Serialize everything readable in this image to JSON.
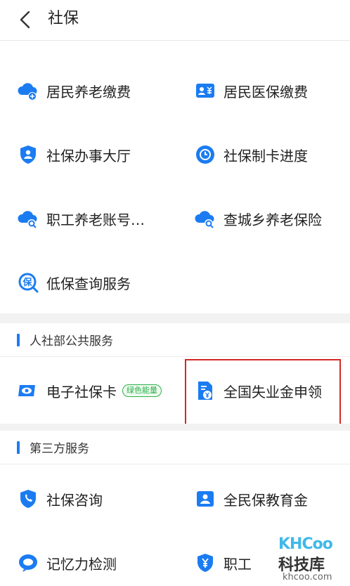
{
  "header": {
    "title": "社保"
  },
  "grid1": [
    {
      "label": "居民养老缴费",
      "icon": "cloud-plus-icon"
    },
    {
      "label": "居民医保缴费",
      "icon": "id-card-yuan-icon"
    },
    {
      "label": "社保办事大厅",
      "icon": "shield-person-icon"
    },
    {
      "label": "社保制卡进度",
      "icon": "clock-progress-icon"
    },
    {
      "label": "职工养老账号…",
      "icon": "cloud-search-icon"
    },
    {
      "label": "查城乡养老保险",
      "icon": "cloud-search-icon"
    },
    {
      "label": "低保查询服务",
      "icon": "bao-search-icon"
    }
  ],
  "section2": {
    "title": "人社部公共服务",
    "items": [
      {
        "label": "电子社保卡",
        "badge": "绿色能量",
        "icon": "eye-card-icon"
      },
      {
        "label": "全国失业金申领",
        "icon": "document-yuan-icon"
      }
    ]
  },
  "section3": {
    "title": "第三方服务",
    "items": [
      {
        "label": "社保咨询",
        "icon": "shield-phone-icon"
      },
      {
        "label": "全民保教育金",
        "icon": "person-card-icon"
      },
      {
        "label": "记忆力检测",
        "icon": "brain-icon"
      },
      {
        "label": "职工",
        "icon": "yuan-shield-icon"
      }
    ]
  },
  "watermark": {
    "brand": "KHCoo",
    "cn": "科技库",
    "url": "khcoo.com"
  },
  "colors": {
    "accent": "#1b7cf2",
    "highlight": "#d62828",
    "badge": "#2db04a"
  }
}
